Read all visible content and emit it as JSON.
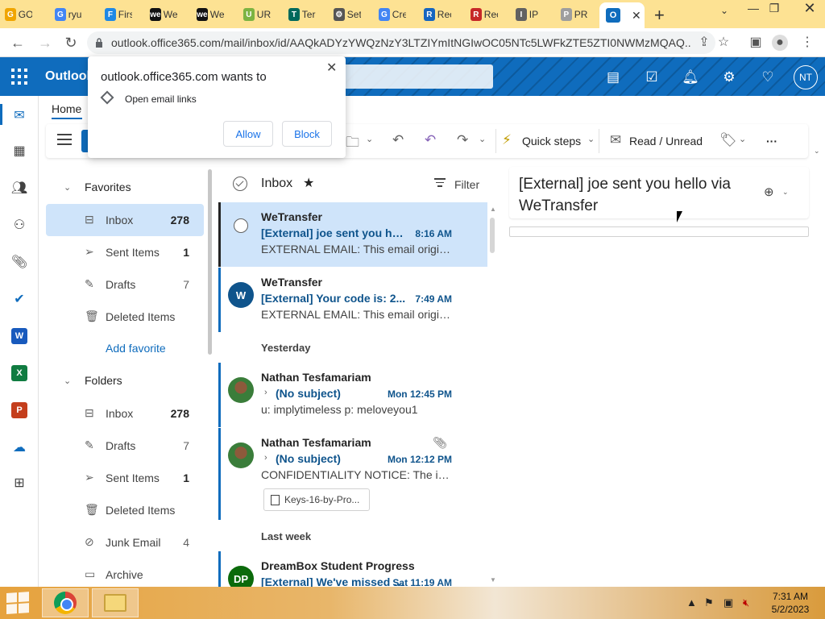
{
  "browser": {
    "tabs": [
      {
        "short": "GO",
        "icon": "tab-favicon"
      },
      {
        "short": "ryu",
        "icon": "google-icon"
      },
      {
        "short": "Firs",
        "icon": "tab-favicon"
      },
      {
        "short": "We",
        "icon": "wetransfer-icon"
      },
      {
        "short": "We",
        "icon": "wetransfer-icon"
      },
      {
        "short": "UR",
        "icon": "tab-favicon"
      },
      {
        "short": "Ter",
        "icon": "tab-favicon"
      },
      {
        "short": "Set",
        "icon": "gear-icon"
      },
      {
        "short": "Cre",
        "icon": "google-icon"
      },
      {
        "short": "Rec",
        "icon": "tab-favicon"
      },
      {
        "short": "Rec",
        "icon": "tab-favicon"
      },
      {
        "short": "IP",
        "icon": "tab-favicon"
      },
      {
        "short": "PR",
        "icon": "tab-favicon"
      }
    ],
    "active_tab_icon": "O",
    "url": "outlook.office365.com/mail/inbox/id/AAQkADYzYWQzNzY3LTZIYmItNGIwOC05NTc5LWFkZTE5ZTI0NWMzMQAQ..."
  },
  "outlook": {
    "brand": "Outlook",
    "avatar_initials": "NT",
    "ribbon_tab": "Home",
    "ribbon": {
      "quick_steps": "Quick steps",
      "read_unread": "Read / Unread",
      "more": "···"
    }
  },
  "popup": {
    "title": "outlook.office365.com wants to",
    "description": "Open email links",
    "allow": "Allow",
    "block": "Block"
  },
  "folders": {
    "favorites_label": "Favorites",
    "favorites": [
      {
        "name": "Inbox",
        "count": "278"
      },
      {
        "name": "Sent Items",
        "count": "1"
      },
      {
        "name": "Drafts",
        "count": "7"
      },
      {
        "name": "Deleted Items",
        "count": ""
      }
    ],
    "add_favorite": "Add favorite",
    "folders_label": "Folders",
    "all": [
      {
        "name": "Inbox",
        "count": "278"
      },
      {
        "name": "Drafts",
        "count": "7"
      },
      {
        "name": "Sent Items",
        "count": "1"
      },
      {
        "name": "Deleted Items",
        "count": ""
      },
      {
        "name": "Junk Email",
        "count": "4"
      },
      {
        "name": "Archive",
        "count": ""
      }
    ]
  },
  "message_list": {
    "title": "Inbox",
    "filter": "Filter",
    "group_yesterday": "Yesterday",
    "group_last_week": "Last week",
    "messages": [
      {
        "from": "WeTransfer",
        "subject": "[External] joe sent you hello via WeTransfer",
        "time": "8:16 AM",
        "preview": "EXTERNAL EMAIL: This email originated from outside",
        "avatar": ""
      },
      {
        "from": "WeTransfer",
        "subject": "[External] Your code is: 2...",
        "time": "7:49 AM",
        "preview": "EXTERNAL EMAIL: This email originated from outside",
        "avatar": "W"
      },
      {
        "from": "Nathan Tesfamariam",
        "subject": "(No subject)",
        "time": "Mon 12:45 PM",
        "preview": "u: implytimeless p: meloveyou1",
        "avatar": ""
      },
      {
        "from": "Nathan Tesfamariam",
        "subject": "(No subject)",
        "time": "Mon 12:12 PM",
        "preview": "CONFIDENTIALITY NOTICE: The information contained",
        "avatar": "",
        "attachment": "Keys-16-by-Pro..."
      },
      {
        "from": "DreamBox Student Progress",
        "subject": "[External] We've missed you",
        "time": "Sat 11:19 AM",
        "preview": "",
        "avatar": "DP"
      }
    ]
  },
  "reading_pane": {
    "subject": "[External] joe sent you hello via WeTransfer"
  },
  "taskbar": {
    "time": "7:31 AM",
    "date": "5/2/2023"
  },
  "colors": {
    "outlook_blue": "#0f6cbd",
    "selection": "#cfe4fa",
    "chrome_tabstrip": "#fde293"
  }
}
